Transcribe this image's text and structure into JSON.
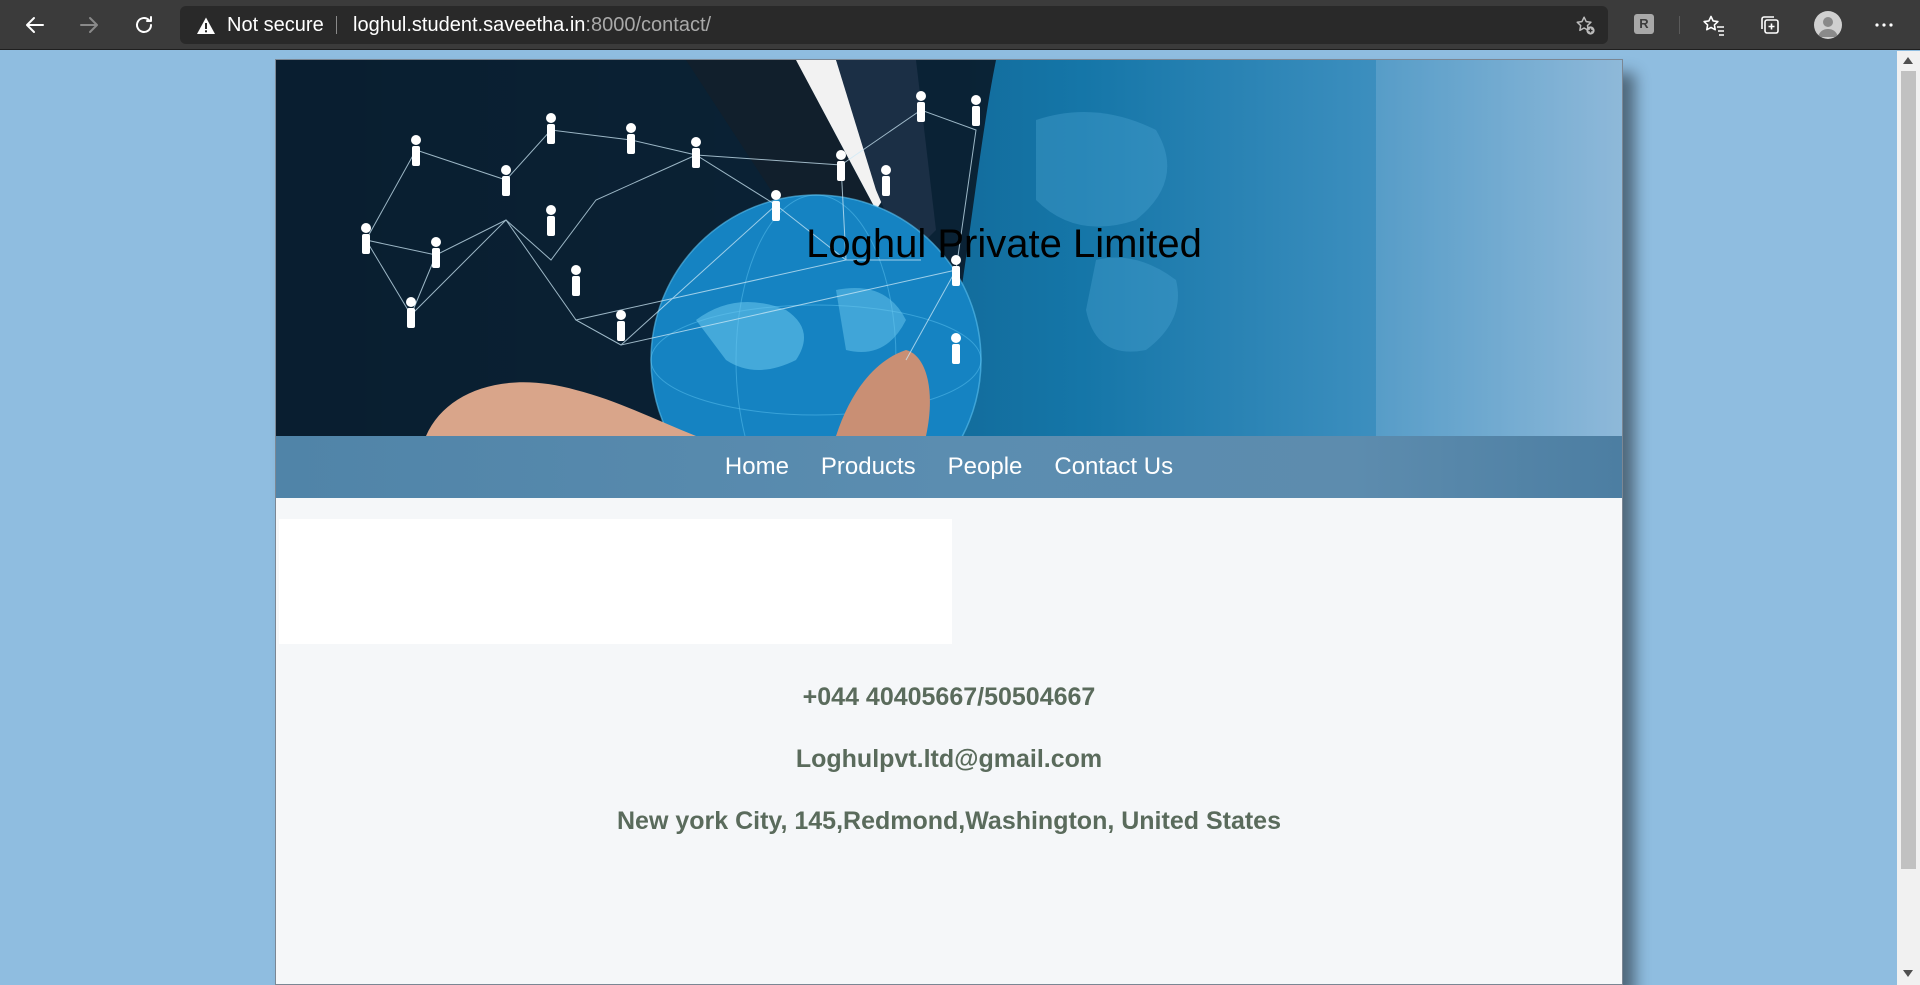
{
  "browser": {
    "security_label": "Not secure",
    "url_host": "loghul.student.saveetha.in",
    "url_path": ":8000/contact/",
    "extension_letter": "R",
    "icons": [
      "back-arrow-icon",
      "forward-arrow-icon",
      "refresh-icon",
      "warning-icon",
      "add-favorite-icon",
      "extension-icon",
      "favorites-icon",
      "collections-icon",
      "profile-avatar-icon",
      "more-options-icon"
    ]
  },
  "site": {
    "company_name": "Loghul Private Limited",
    "nav": [
      {
        "label": "Home"
      },
      {
        "label": "Products"
      },
      {
        "label": "People"
      },
      {
        "label": "Contact Us"
      }
    ]
  },
  "contact": {
    "phone": "+044 40405667/50504667",
    "email": "Loghulpvt.ltd@gmail.com",
    "address": "New york City, 145,Redmond,Washington, United States"
  },
  "colors": {
    "page_background": "#8fbde0",
    "nav_background": "#5b8db0",
    "contact_text": "#5a6b5c",
    "browser_chrome": "#3b3b3b"
  }
}
